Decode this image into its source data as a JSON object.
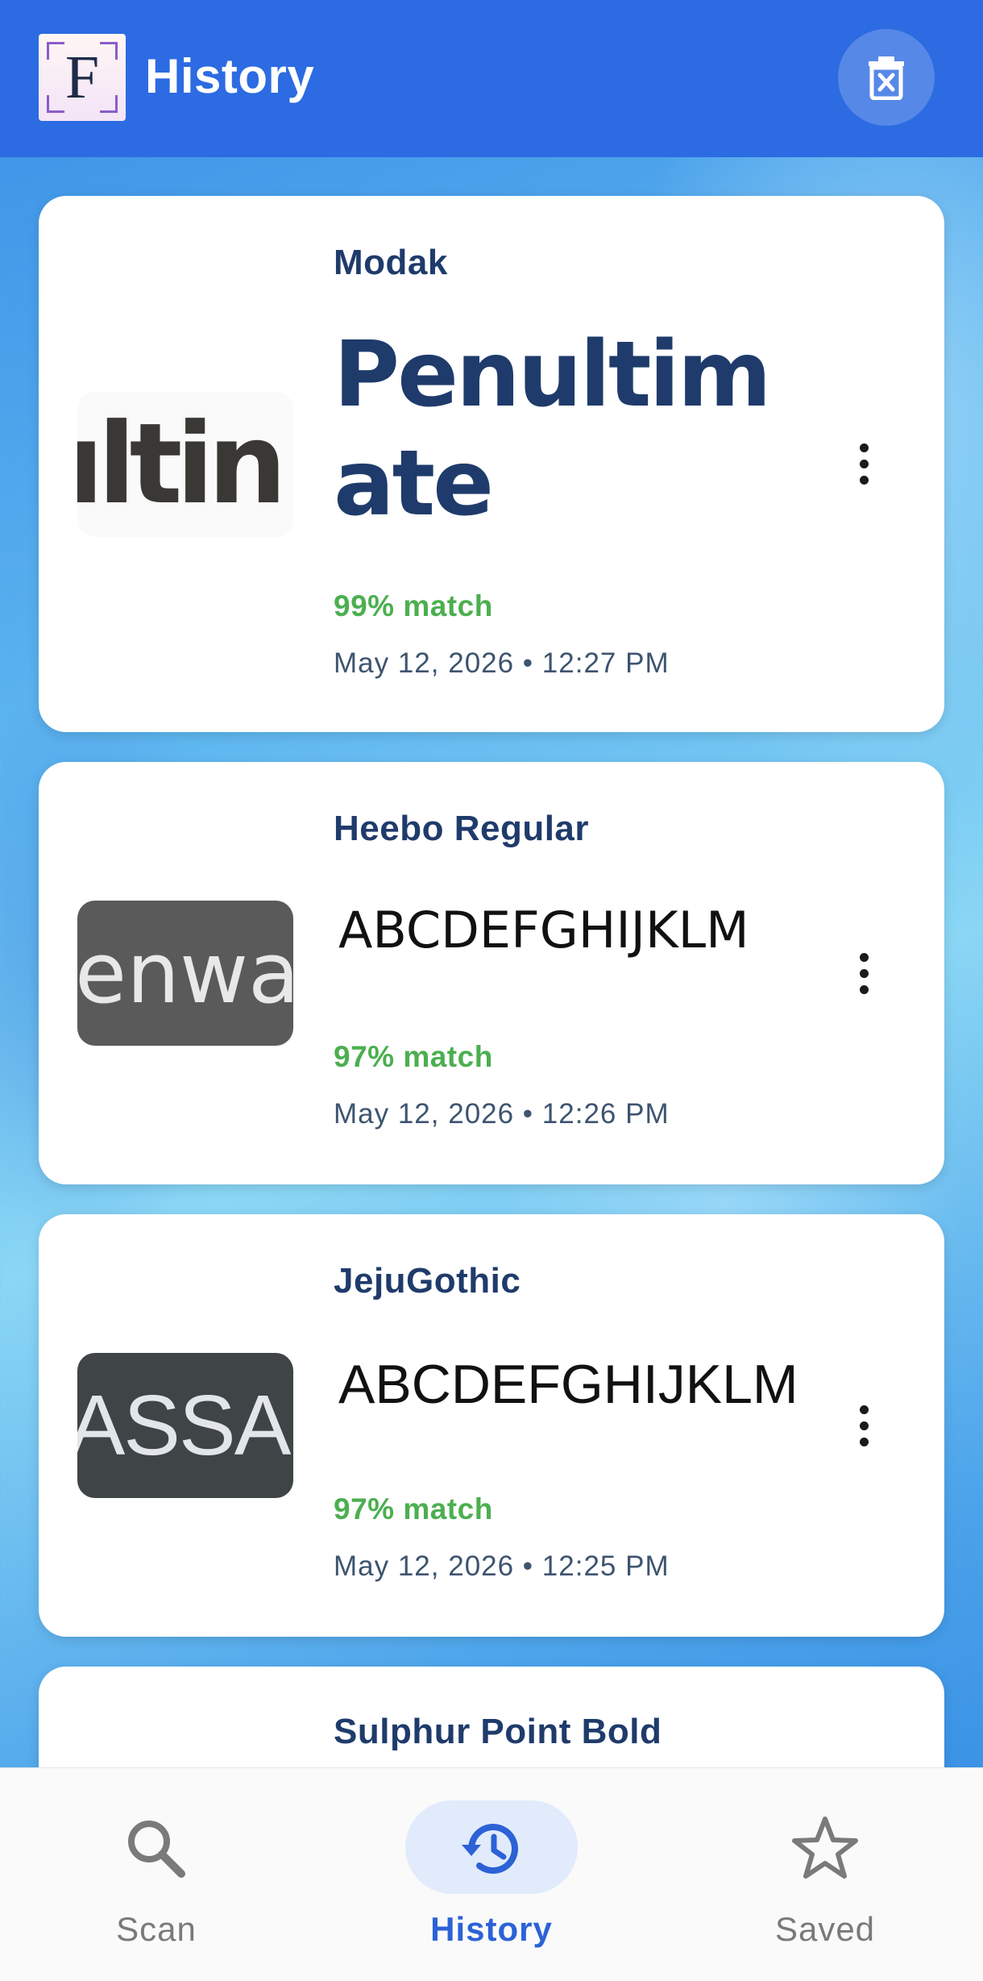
{
  "header": {
    "title": "History",
    "logo_letter": "F",
    "delete_icon": "delete-all-icon"
  },
  "history": [
    {
      "font_name": "Modak",
      "sample": "Penultim ate",
      "sample_line1": "Penultim",
      "sample_line2": "ate",
      "thumb_text": "ıltin",
      "match": "99% match",
      "date": "May 12, 2026 • 12:27 PM"
    },
    {
      "font_name": "Heebo Regular",
      "sample": "ABCDEFGHIJKLM",
      "thumb_text": "ienwa",
      "match": "97% match",
      "date": "May 12, 2026 • 12:26 PM"
    },
    {
      "font_name": "JejuGothic",
      "sample": "ABCDEFGHIJKLM",
      "thumb_text": "ASSA",
      "match": "97% match",
      "date": "May 12, 2026 • 12:25 PM"
    },
    {
      "font_name": "Sulphur Point Bold"
    }
  ],
  "nav": {
    "items": [
      {
        "label": "Scan",
        "icon": "search-icon",
        "active": false
      },
      {
        "label": "History",
        "icon": "history-icon",
        "active": true
      },
      {
        "label": "Saved",
        "icon": "star-icon",
        "active": false
      }
    ]
  },
  "colors": {
    "app_bar": "#2c6be2",
    "font_name": "#1f3b6b",
    "match": "#4caf50",
    "nav_active": "#2c62d6"
  }
}
